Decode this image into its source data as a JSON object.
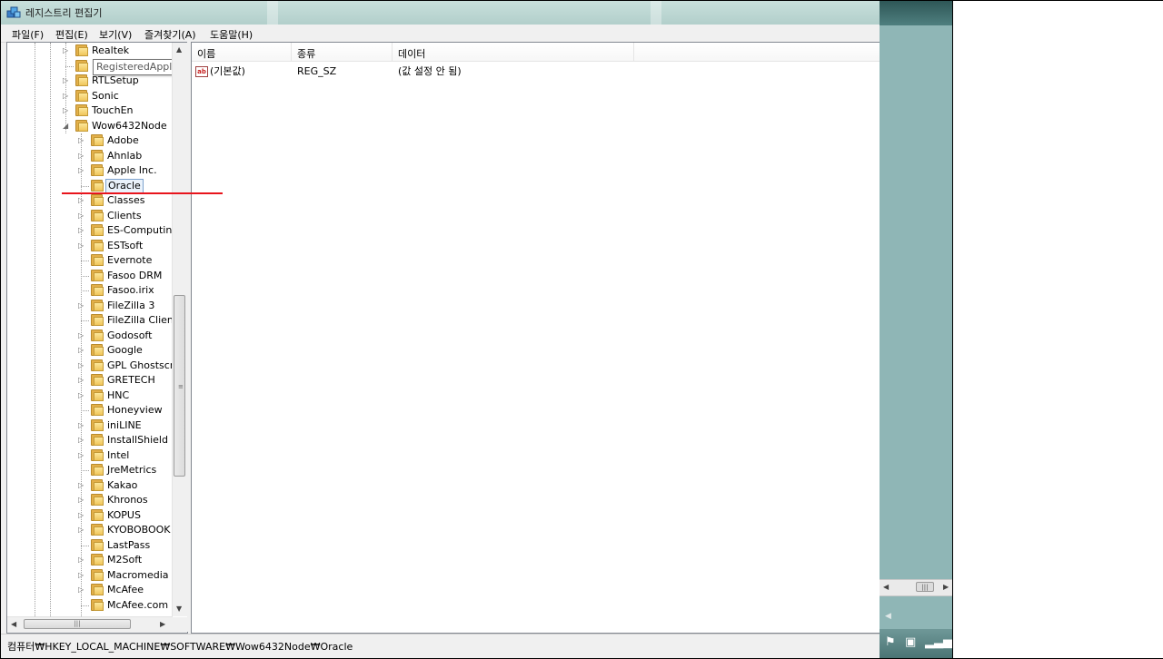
{
  "window": {
    "title": "레지스트리 편집기"
  },
  "menu": [
    "파일(F)",
    "편집(E)",
    "보기(V)",
    "즐겨찾기(A)",
    "도움말(H)"
  ],
  "tree": {
    "tooltip": "RegisteredApplications",
    "top_nodes": [
      {
        "label": "Realtek",
        "expandable": true
      },
      {
        "label": "RegisteredApplications",
        "expandable": false
      },
      {
        "label": "RTLSetup",
        "expandable": true
      },
      {
        "label": "Sonic",
        "expandable": true
      },
      {
        "label": "TouchEn",
        "expandable": true
      },
      {
        "label": "Wow6432Node",
        "expandable": true,
        "expanded": true
      }
    ],
    "children": [
      {
        "label": "Adobe",
        "expandable": true
      },
      {
        "label": "Ahnlab",
        "expandable": true
      },
      {
        "label": "Apple Inc.",
        "expandable": true
      },
      {
        "label": "Oracle",
        "expandable": false,
        "selected": true
      },
      {
        "label": "Classes",
        "expandable": true
      },
      {
        "label": "Clients",
        "expandable": true
      },
      {
        "label": "ES-Computing",
        "expandable": true
      },
      {
        "label": "ESTsoft",
        "expandable": true
      },
      {
        "label": "Evernote",
        "expandable": false
      },
      {
        "label": "Fasoo DRM",
        "expandable": false
      },
      {
        "label": "Fasoo.irix",
        "expandable": false
      },
      {
        "label": "FileZilla 3",
        "expandable": true
      },
      {
        "label": "FileZilla Client",
        "expandable": false
      },
      {
        "label": "Godosoft",
        "expandable": true
      },
      {
        "label": "Google",
        "expandable": true
      },
      {
        "label": "GPL Ghostscript",
        "expandable": true
      },
      {
        "label": "GRETECH",
        "expandable": true
      },
      {
        "label": "HNC",
        "expandable": true
      },
      {
        "label": "Honeyview",
        "expandable": false
      },
      {
        "label": "iniLINE",
        "expandable": true
      },
      {
        "label": "InstallShield",
        "expandable": true
      },
      {
        "label": "Intel",
        "expandable": true
      },
      {
        "label": "JreMetrics",
        "expandable": false
      },
      {
        "label": "Kakao",
        "expandable": true
      },
      {
        "label": "Khronos",
        "expandable": true
      },
      {
        "label": "KOPUS",
        "expandable": true
      },
      {
        "label": "KYOBOBOOK",
        "expandable": true
      },
      {
        "label": "LastPass",
        "expandable": false
      },
      {
        "label": "M2Soft",
        "expandable": true
      },
      {
        "label": "Macromedia",
        "expandable": true
      },
      {
        "label": "McAfee",
        "expandable": true
      },
      {
        "label": "McAfee.com",
        "expandable": false
      }
    ]
  },
  "list": {
    "columns": [
      "이름",
      "종류",
      "데이터"
    ],
    "rows": [
      {
        "icon": "string-value-icon",
        "name": "(기본값)",
        "type": "REG_SZ",
        "data": "(값 설정 안 됨)"
      }
    ]
  },
  "status": {
    "path": "컴퓨터₩HKEY_LOCAL_MACHINE₩SOFTWARE₩Wow6432Node₩Oracle"
  },
  "colors": {
    "annotation_line": "#e8141c",
    "selection_border": "#7da2ce",
    "desktop": "#8fb6b6"
  }
}
